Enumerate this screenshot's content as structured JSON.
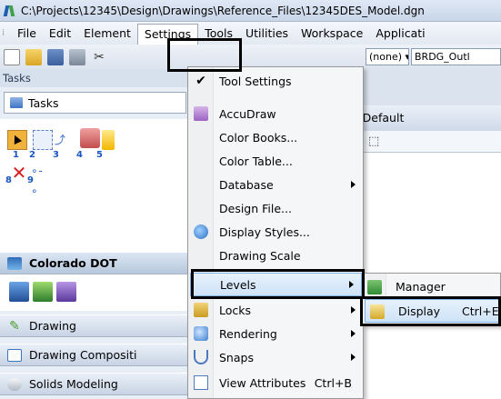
{
  "window": {
    "title": "C:\\Projects\\12345\\Design\\Drawings\\Reference_Files\\12345DES_Model.dgn"
  },
  "menubar": {
    "items": [
      "File",
      "Edit",
      "Element",
      "Settings",
      "Tools",
      "Utilities",
      "Workspace",
      "Applicati"
    ]
  },
  "toolbar": {
    "level_dropdown": "(none)",
    "style_dropdown": "BRDG_Outl"
  },
  "tasks": {
    "caption": "Tasks",
    "combo_value": "Tasks",
    "tool_numbers": [
      "1",
      "2",
      "3",
      "4",
      "5",
      "8",
      "9"
    ],
    "groups": {
      "colorado": "Colorado DOT",
      "drawing": "Drawing",
      "drawing_composition": "Drawing Compositi",
      "solids": "Solids Modeling"
    }
  },
  "view": {
    "caption": "p, CDOT Default"
  },
  "settings_menu": {
    "items": [
      {
        "label": "Tool Settings",
        "checked": true,
        "submenu": false,
        "shortcut": ""
      },
      {
        "label": "AccuDraw",
        "submenu": false,
        "shortcut": ""
      },
      {
        "label": "Color Books...",
        "submenu": false,
        "shortcut": ""
      },
      {
        "label": "Color Table...",
        "submenu": false,
        "shortcut": ""
      },
      {
        "label": "Database",
        "submenu": true,
        "shortcut": ""
      },
      {
        "label": "Design File...",
        "submenu": false,
        "shortcut": ""
      },
      {
        "label": "Display Styles...",
        "submenu": false,
        "shortcut": ""
      },
      {
        "label": "Drawing Scale",
        "submenu": false,
        "shortcut": ""
      },
      {
        "label": "Levels",
        "submenu": true,
        "shortcut": ""
      },
      {
        "label": "Locks",
        "submenu": true,
        "shortcut": ""
      },
      {
        "label": "Rendering",
        "submenu": true,
        "shortcut": ""
      },
      {
        "label": "Snaps",
        "submenu": true,
        "shortcut": ""
      },
      {
        "label": "View Attributes",
        "submenu": false,
        "shortcut": "Ctrl+B"
      }
    ]
  },
  "levels_submenu": {
    "items": [
      {
        "label": "Manager",
        "shortcut": ""
      },
      {
        "label": "Display",
        "shortcut": "Ctrl+E"
      }
    ]
  },
  "colors": {
    "highlight": "#cfe3f8",
    "frame": "#000000"
  }
}
